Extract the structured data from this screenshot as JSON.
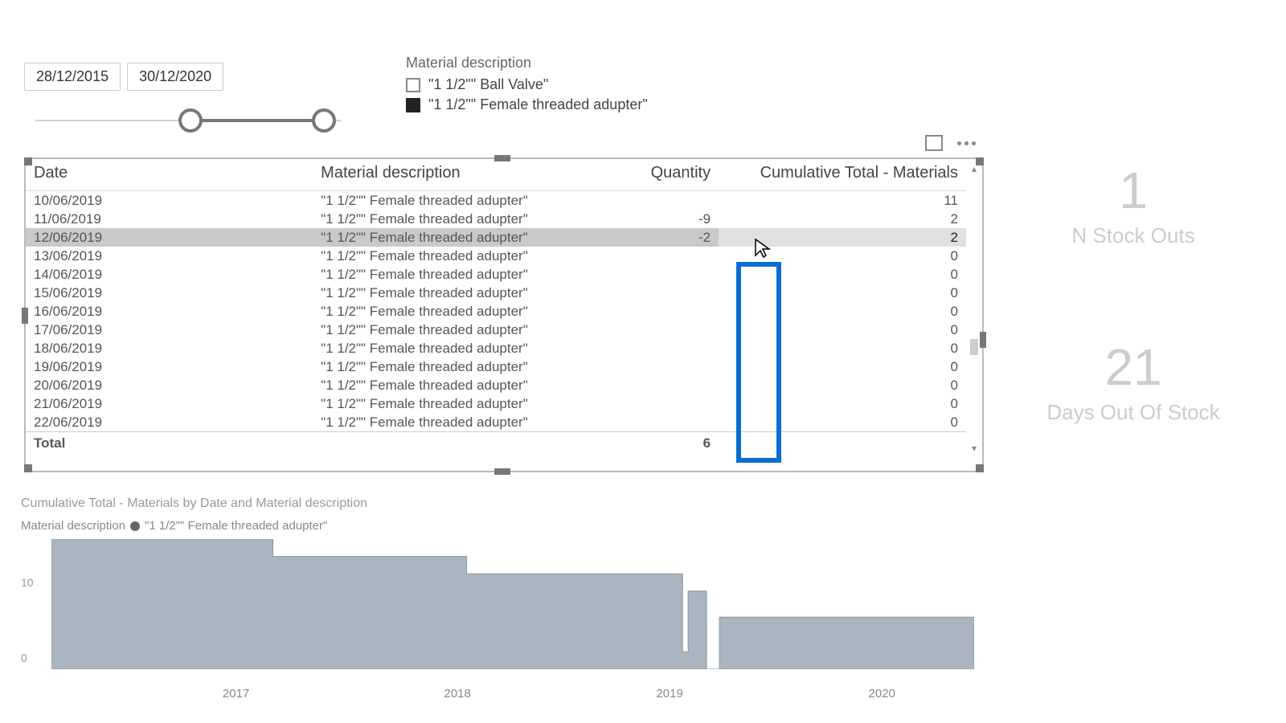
{
  "date_slicer": {
    "from": "28/12/2015",
    "to": "30/12/2020"
  },
  "material_slicer": {
    "title": "Material description",
    "options": [
      {
        "label": "\"1 1/2\"\" Ball Valve\"",
        "checked": false
      },
      {
        "label": "\"1 1/2\"\" Female threaded adupter\"",
        "checked": true
      }
    ]
  },
  "table": {
    "columns": {
      "date": "Date",
      "material": "Material description",
      "qty": "Quantity",
      "cum": "Cumulative Total - Materials"
    },
    "rows": [
      {
        "date": "10/06/2019",
        "material": "\"1 1/2\"\" Female threaded adupter\"",
        "qty": "",
        "cum": "11",
        "sel": false
      },
      {
        "date": "11/06/2019",
        "material": "\"1 1/2\"\" Female threaded adupter\"",
        "qty": "-9",
        "cum": "2",
        "sel": false
      },
      {
        "date": "12/06/2019",
        "material": "\"1 1/2\"\" Female threaded adupter\"",
        "qty": "-2",
        "cum": "2",
        "sel": true
      },
      {
        "date": "13/06/2019",
        "material": "\"1 1/2\"\" Female threaded adupter\"",
        "qty": "",
        "cum": "0",
        "sel": false
      },
      {
        "date": "14/06/2019",
        "material": "\"1 1/2\"\" Female threaded adupter\"",
        "qty": "",
        "cum": "0",
        "sel": false
      },
      {
        "date": "15/06/2019",
        "material": "\"1 1/2\"\" Female threaded adupter\"",
        "qty": "",
        "cum": "0",
        "sel": false
      },
      {
        "date": "16/06/2019",
        "material": "\"1 1/2\"\" Female threaded adupter\"",
        "qty": "",
        "cum": "0",
        "sel": false
      },
      {
        "date": "17/06/2019",
        "material": "\"1 1/2\"\" Female threaded adupter\"",
        "qty": "",
        "cum": "0",
        "sel": false
      },
      {
        "date": "18/06/2019",
        "material": "\"1 1/2\"\" Female threaded adupter\"",
        "qty": "",
        "cum": "0",
        "sel": false
      },
      {
        "date": "19/06/2019",
        "material": "\"1 1/2\"\" Female threaded adupter\"",
        "qty": "",
        "cum": "0",
        "sel": false
      },
      {
        "date": "20/06/2019",
        "material": "\"1 1/2\"\" Female threaded adupter\"",
        "qty": "",
        "cum": "0",
        "sel": false
      },
      {
        "date": "21/06/2019",
        "material": "\"1 1/2\"\" Female threaded adupter\"",
        "qty": "",
        "cum": "0",
        "sel": false
      },
      {
        "date": "22/06/2019",
        "material": "\"1 1/2\"\" Female threaded adupter\"",
        "qty": "",
        "cum": "0",
        "sel": false
      }
    ],
    "total": {
      "label": "Total",
      "qty": "6",
      "cum": ""
    }
  },
  "kpi": {
    "stockouts": {
      "value": "1",
      "label": "N Stock Outs"
    },
    "days": {
      "value": "21",
      "label": "Days Out Of Stock"
    }
  },
  "chart": {
    "title": "Cumulative Total - Materials by Date and Material description",
    "legend_title": "Material description",
    "legend_item": "\"1 1/2\"\" Female threaded adupter\"",
    "y_ticks": [
      "10",
      "0"
    ],
    "x_ticks": [
      "2017",
      "2018",
      "2019",
      "2020"
    ]
  },
  "chart_data": {
    "type": "area",
    "title": "Cumulative Total - Materials by Date and Material description",
    "xlabel": "",
    "ylabel": "",
    "ylim": [
      0,
      15
    ],
    "series": [
      {
        "name": "\"1 1/2\"\" Female threaded adupter\"",
        "x": [
          2016.0,
          2017.2,
          2017.2,
          2018.25,
          2018.25,
          2019.42,
          2019.42,
          2019.45,
          2019.45,
          2019.55,
          2019.55,
          2019.62,
          2019.62,
          2021.0
        ],
        "values": [
          15,
          15,
          13,
          13,
          11,
          11,
          2,
          2,
          9,
          9,
          0,
          0,
          6,
          6
        ]
      }
    ]
  }
}
